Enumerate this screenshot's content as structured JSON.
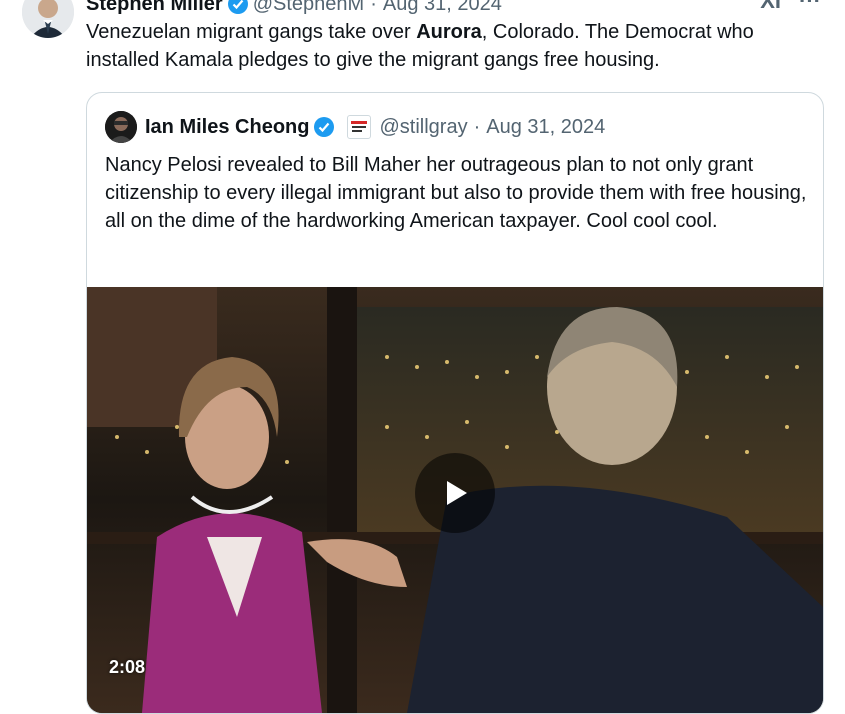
{
  "tweet": {
    "author_name": "Stephen Miller",
    "handle": "@StephenM",
    "date": "Aug 31, 2024",
    "text_before": "Venezuelan migrant gangs take over ",
    "text_bold": "Aurora",
    "text_after": ", Colorado. The Democrat who installed Kamala pledges to give the migrant gangs free housing."
  },
  "quote": {
    "author_name": "Ian Miles Cheong",
    "handle": "@stillgray",
    "date": "Aug 31, 2024",
    "text": "Nancy Pelosi revealed to Bill Maher her outrageous plan to not only grant citizenship to every illegal immigrant but also to provide them with free housing, all on the dime of the hardworking American taxpayer. Cool cool cool."
  },
  "video": {
    "duration": "2:08"
  },
  "colors": {
    "verified": "#1d9bf0",
    "muted": "#536471",
    "border": "#cfd9de"
  },
  "icons": {
    "verified": "verified-badge-icon",
    "play": "play-icon",
    "grok": "grok-icon",
    "more": "more-icon",
    "affiliate": "affiliate-badge-icon"
  },
  "top_icons": {
    "grok_label": "XI",
    "more_label": "···"
  },
  "separator": "·"
}
